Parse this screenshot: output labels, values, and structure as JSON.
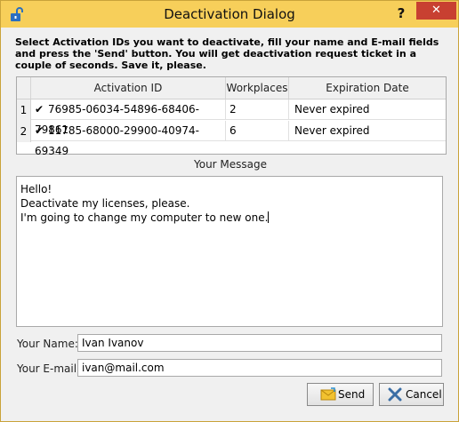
{
  "window": {
    "title": "Deactivation Dialog",
    "help_label": "?",
    "close_label": "✕"
  },
  "instructions": "Select Activation IDs you want to deactivate, fill your name and E-mail fields and press the 'Send' button. You will get deactivation request ticket in a couple of seconds. Save it, please.",
  "table": {
    "columns": [
      "Activation ID",
      "Workplaces",
      "Expiration Date"
    ],
    "rows": [
      {
        "num": "1",
        "checked": true,
        "activation_id": "76985-06034-54896-68406-79861",
        "workplaces": "2",
        "expiration": "Never expired"
      },
      {
        "num": "2",
        "checked": true,
        "activation_id": "11785-68000-29900-40974-69349",
        "workplaces": "6",
        "expiration": "Never expired"
      }
    ]
  },
  "message": {
    "label": "Your Message",
    "lines": [
      "Hello!",
      "Deactivate my licenses, please.",
      "I'm going to change my computer to new one."
    ]
  },
  "form": {
    "name_label": "Your Name:",
    "name_value": "Ivan Ivanov",
    "email_label": "Your E-mail:",
    "email_value": "ivan@mail.com"
  },
  "buttons": {
    "send": "Send",
    "cancel": "Cancel"
  },
  "colors": {
    "titlebar": "#f7cf5a",
    "close": "#c84031",
    "lock_icon": "#2a6fc0"
  },
  "icons": {
    "title": "unlock-icon",
    "send": "envelope-icon",
    "cancel": "cancel-x-icon"
  }
}
